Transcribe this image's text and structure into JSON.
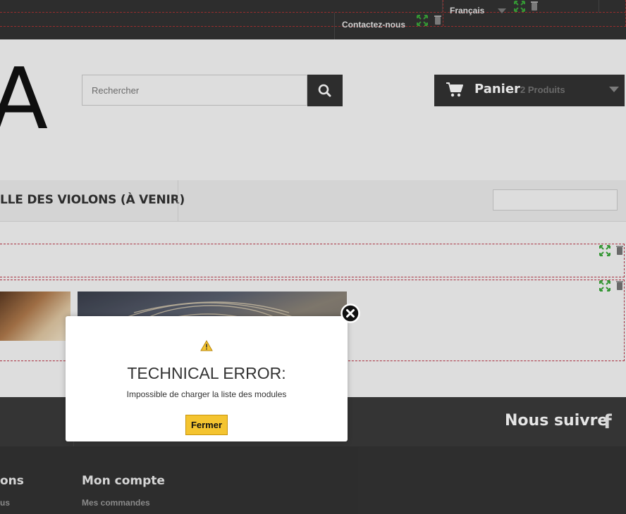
{
  "topbar": {
    "language": "Français",
    "contact": "Contactez-nous"
  },
  "header": {
    "logo_letter": "A",
    "search_placeholder": "Rechercher",
    "cart_label": "Panier",
    "cart_count": "2 Produits"
  },
  "menu": {
    "item": "LLE DES VIOLONS (À VENIR)"
  },
  "footer": {
    "follow": "Nous suivre",
    "facebook_glyph": "f",
    "col1_title": "ons",
    "col1_link": "us",
    "col2_title": "Mon compte",
    "col2_link": "Mes commandes"
  },
  "modal": {
    "title": "TECHNICAL ERROR:",
    "message": "Impossible de charger la liste des modules",
    "close_label": "Fermer"
  },
  "colors": {
    "topbar": "#333333",
    "accent_button": "#f4c430",
    "edit_dashes": "#aa3344"
  },
  "icons": [
    "move-icon",
    "trash-icon",
    "search-icon",
    "cart-icon",
    "warning-icon",
    "close-icon",
    "facebook-icon"
  ]
}
